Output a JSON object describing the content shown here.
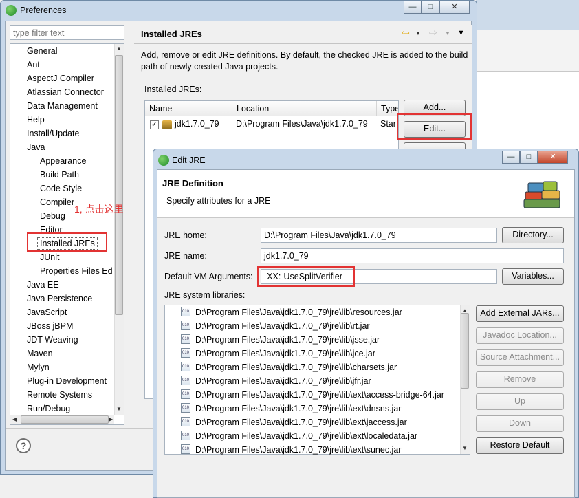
{
  "preferences": {
    "title": "Preferences",
    "filter_placeholder": "type filter text",
    "tree": [
      {
        "label": "General",
        "level": 0
      },
      {
        "label": "Ant",
        "level": 0
      },
      {
        "label": "AspectJ Compiler",
        "level": 0
      },
      {
        "label": "Atlassian Connector",
        "level": 0
      },
      {
        "label": "Data Management",
        "level": 0
      },
      {
        "label": "Help",
        "level": 0
      },
      {
        "label": "Install/Update",
        "level": 0
      },
      {
        "label": "Java",
        "level": 0
      },
      {
        "label": "Appearance",
        "level": 1
      },
      {
        "label": "Build Path",
        "level": 1
      },
      {
        "label": "Code Style",
        "level": 1
      },
      {
        "label": "Compiler",
        "level": 1
      },
      {
        "label": "Debug",
        "level": 1
      },
      {
        "label": "Editor",
        "level": 1
      },
      {
        "label": "Installed JREs",
        "level": 1,
        "selected": true
      },
      {
        "label": "JUnit",
        "level": 1
      },
      {
        "label": "Properties Files Ed",
        "level": 1
      },
      {
        "label": "Java EE",
        "level": 0
      },
      {
        "label": "Java Persistence",
        "level": 0
      },
      {
        "label": "JavaScript",
        "level": 0
      },
      {
        "label": "JBoss jBPM",
        "level": 0
      },
      {
        "label": "JDT Weaving",
        "level": 0
      },
      {
        "label": "Maven",
        "level": 0
      },
      {
        "label": "Mylyn",
        "level": 0
      },
      {
        "label": "Plug-in Development",
        "level": 0
      },
      {
        "label": "Remote Systems",
        "level": 0
      },
      {
        "label": "Run/Debug",
        "level": 0
      }
    ],
    "page_title": "Installed JREs",
    "description": "Add, remove or edit JRE definitions. By default, the checked JRE is added to the build path of newly created Java projects.",
    "installed_label": "Installed JREs:",
    "columns": [
      "Name",
      "Location",
      "Type"
    ],
    "rows": [
      {
        "name": "jdk1.7.0_79",
        "location": "D:\\Program Files\\Java\\jdk1.7.0_79",
        "type": "Star",
        "checked": true
      }
    ],
    "buttons": {
      "add": "Add...",
      "edit": "Edit..."
    },
    "annotation": "1, 点击这里"
  },
  "edit_jre": {
    "title": "Edit JRE",
    "banner_title": "JRE Definition",
    "banner_subtitle": "Specify attributes for a JRE",
    "jre_home_label": "JRE home:",
    "jre_home_value": "D:\\Program Files\\Java\\jdk1.7.0_79",
    "jre_name_label": "JRE name:",
    "jre_name_value": "jdk1.7.0_79",
    "vm_args_label": "Default VM Arguments:",
    "vm_args_value": "-XX:-UseSplitVerifier",
    "libraries_label": "JRE system libraries:",
    "libraries": [
      "D:\\Program Files\\Java\\jdk1.7.0_79\\jre\\lib\\resources.jar",
      "D:\\Program Files\\Java\\jdk1.7.0_79\\jre\\lib\\rt.jar",
      "D:\\Program Files\\Java\\jdk1.7.0_79\\jre\\lib\\jsse.jar",
      "D:\\Program Files\\Java\\jdk1.7.0_79\\jre\\lib\\jce.jar",
      "D:\\Program Files\\Java\\jdk1.7.0_79\\jre\\lib\\charsets.jar",
      "D:\\Program Files\\Java\\jdk1.7.0_79\\jre\\lib\\jfr.jar",
      "D:\\Program Files\\Java\\jdk1.7.0_79\\jre\\lib\\ext\\access-bridge-64.jar",
      "D:\\Program Files\\Java\\jdk1.7.0_79\\jre\\lib\\ext\\dnsns.jar",
      "D:\\Program Files\\Java\\jdk1.7.0_79\\jre\\lib\\ext\\jaccess.jar",
      "D:\\Program Files\\Java\\jdk1.7.0_79\\jre\\lib\\ext\\localedata.jar",
      "D:\\Program Files\\Java\\jdk1.7.0_79\\jre\\lib\\ext\\sunec.jar"
    ],
    "buttons": {
      "directory": "Directory...",
      "variables": "Variables...",
      "add_external": "Add External JARs...",
      "javadoc": "Javadoc Location...",
      "source": "Source Attachment...",
      "remove": "Remove",
      "up": "Up",
      "down": "Down",
      "restore": "Restore Default"
    }
  },
  "colors": {
    "highlight_red": "#e23333",
    "title_bar": "#c8d8ea"
  }
}
